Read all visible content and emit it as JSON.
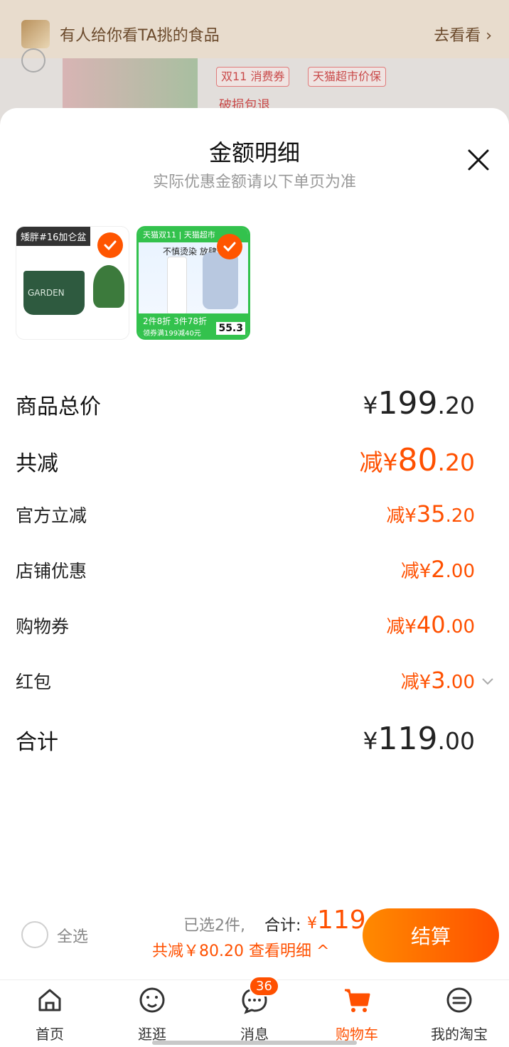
{
  "background": {
    "banner_text": "有人给你看TA挑的食品",
    "banner_link": "去看看",
    "tags": [
      "双11 消费券",
      "天猫超市价保"
    ],
    "extra_text": "破损包退"
  },
  "sheet": {
    "title": "金额明细",
    "subtitle": "实际优惠金额请以下单页为准"
  },
  "products": [
    {
      "label": "矮胖#16加仑盆",
      "image_text": "GARDEN"
    },
    {
      "top_text": "天猫双11 | 天猫超市",
      "headline": "不慎烫染 放肆造",
      "bottom_text": "2件8折 3件78折",
      "coupon": "领券满199减40元",
      "price": "55.3"
    }
  ],
  "breakdown": {
    "total_price": {
      "label": "商品总价",
      "prefix": "¥",
      "int": "199",
      "dec": ".20"
    },
    "total_discount": {
      "label": "共减",
      "prefix": "减¥",
      "int": "80",
      "dec": ".20"
    },
    "items": [
      {
        "label": "官方立减",
        "prefix": "减¥",
        "int": "35",
        "dec": ".20"
      },
      {
        "label": "店铺优惠",
        "prefix": "减¥",
        "int": "2",
        "dec": ".00"
      },
      {
        "label": "购物券",
        "prefix": "减¥",
        "int": "40",
        "dec": ".00"
      },
      {
        "label": "红包",
        "prefix": "减¥",
        "int": "3",
        "dec": ".00"
      }
    ],
    "subtotal": {
      "label": "合计",
      "prefix": "¥",
      "int": "119",
      "dec": ".00"
    }
  },
  "bottom_bar": {
    "select_all": "全选",
    "selected_count": "已选2件,",
    "sum_label": "合计:",
    "sum_currency": "¥",
    "sum_value": "119",
    "saved_text": "共减￥80.20 查看明细 ^",
    "checkout_label": "结算"
  },
  "tabs": [
    {
      "label": "首页",
      "icon": "home-icon"
    },
    {
      "label": "逛逛",
      "icon": "explore-icon"
    },
    {
      "label": "消息",
      "icon": "message-icon",
      "badge": "36"
    },
    {
      "label": "购物车",
      "icon": "cart-icon",
      "active": true
    },
    {
      "label": "我的淘宝",
      "icon": "profile-icon"
    }
  ],
  "colors": {
    "accent": "#ff5000",
    "green": "#33c24d"
  }
}
